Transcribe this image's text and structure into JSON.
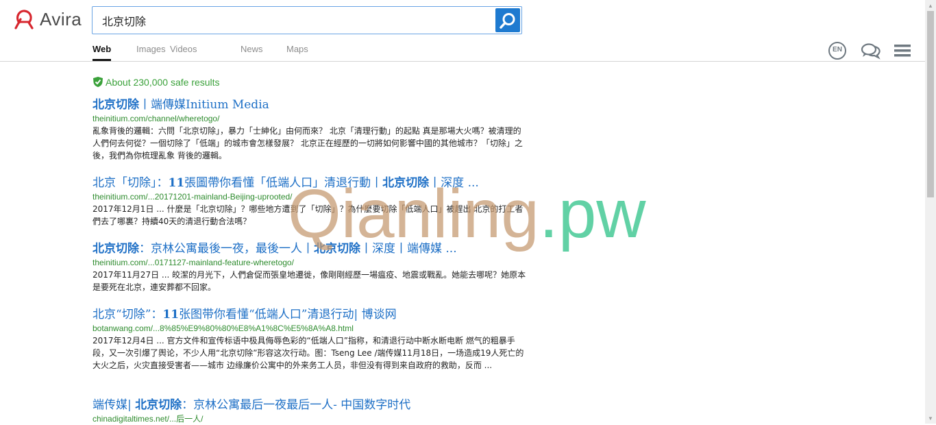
{
  "brand": {
    "name": "Avira",
    "color": "#d7272f"
  },
  "search": {
    "value": "北京切除"
  },
  "tabs": [
    {
      "label": "Web",
      "active": true
    },
    {
      "label": "Images",
      "active": false
    },
    {
      "label": "Videos",
      "active": false
    },
    {
      "label": "News",
      "active": false
    },
    {
      "label": "Maps",
      "active": false
    }
  ],
  "header_icons": {
    "language": "EN"
  },
  "results_count": "About 230,000 safe results",
  "results": [
    {
      "title_parts": [
        {
          "text": "北京切除",
          "bold": true
        },
        {
          "text": "丨端傳媒Initium Media",
          "bold": false
        }
      ],
      "url": "theinitium.com/channel/wheretogo/",
      "snippet": "亂象背後的邏輯：六問「北京切除」，暴力「士紳化」由何而來？ 北京「清理行動」的起點 真是那場大火嗎？被清理的人們何去何從？一個切除了「低端」的城市會怎樣發展？ 北京正在經歷的一切將如何影響中國的其他城市？「切除」之後，我們為你梳理亂象 背後的邏輯。"
    },
    {
      "title_parts": [
        {
          "text": "北京「切除」：",
          "bold": false
        },
        {
          "text": "11",
          "bold": true
        },
        {
          "text": "張圖帶你看懂「低端人口」清退行動丨",
          "bold": false
        },
        {
          "text": "北京切除",
          "bold": true
        },
        {
          "text": "丨深度 ...",
          "bold": false
        }
      ],
      "url": "theinitium.com/...20171201-mainland-Beijing-uprooted/",
      "snippet": "2017年12月1日 ... 什麼是「北京切除」？哪些地方遭到了「切除」？為什麼要切除「低端人口」被趕出 北京的打工者們去了哪裏？持續40天的清退行動合法嗎？"
    },
    {
      "title_parts": [
        {
          "text": "北京切除",
          "bold": true
        },
        {
          "text": "：京林公寓最後一夜，最後一人丨",
          "bold": false
        },
        {
          "text": "北京切除",
          "bold": true
        },
        {
          "text": "丨深度丨端傳媒 ...",
          "bold": false
        }
      ],
      "url": "theinitium.com/...0171127-mainland-feature-wheretogo/",
      "snippet": "2017年11月27日 ... 皎潔的月光下，人們倉促而張皇地遷徙，像剛剛經歷一場瘟疫、地震或戰亂。她能去哪呢？她原本是要死在北京，連安葬都不回家。"
    },
    {
      "title_parts": [
        {
          "text": "北京“切除”：",
          "bold": false
        },
        {
          "text": "11",
          "bold": true
        },
        {
          "text": "张图带你看懂“低端人口”清退行动| 博谈网",
          "bold": false
        }
      ],
      "url": "botanwang.com/...8%85%E9%80%80%E8%A1%8C%E5%8A%A8.html",
      "snippet": "2017年12月4日 ... 官方文件和宣传标语中极具侮辱色彩的“低端人口”指称，和清退行动中断水断电断 燃气的粗暴手段，又一次引爆了舆论，不少人用“北京切除”形容这次行动。图：Tseng Lee /端传媒11月18日，一场造成19人死亡的大火之后，火灾直接受害者——城市 边缘廉价公寓中的外来务工人员，非但没有得到来自政府的救助，反而 ..."
    },
    {
      "title_parts": [
        {
          "text": "端传媒| ",
          "bold": false
        },
        {
          "text": "北京切除",
          "bold": true
        },
        {
          "text": "：京林公寓最后一夜最后一人- 中国数字时代",
          "bold": false
        }
      ],
      "url": "chinadigitaltimes.net/...后一人/",
      "snippet": ""
    }
  ],
  "watermark": {
    "part1": "Qianling",
    "part2": ".pw"
  }
}
